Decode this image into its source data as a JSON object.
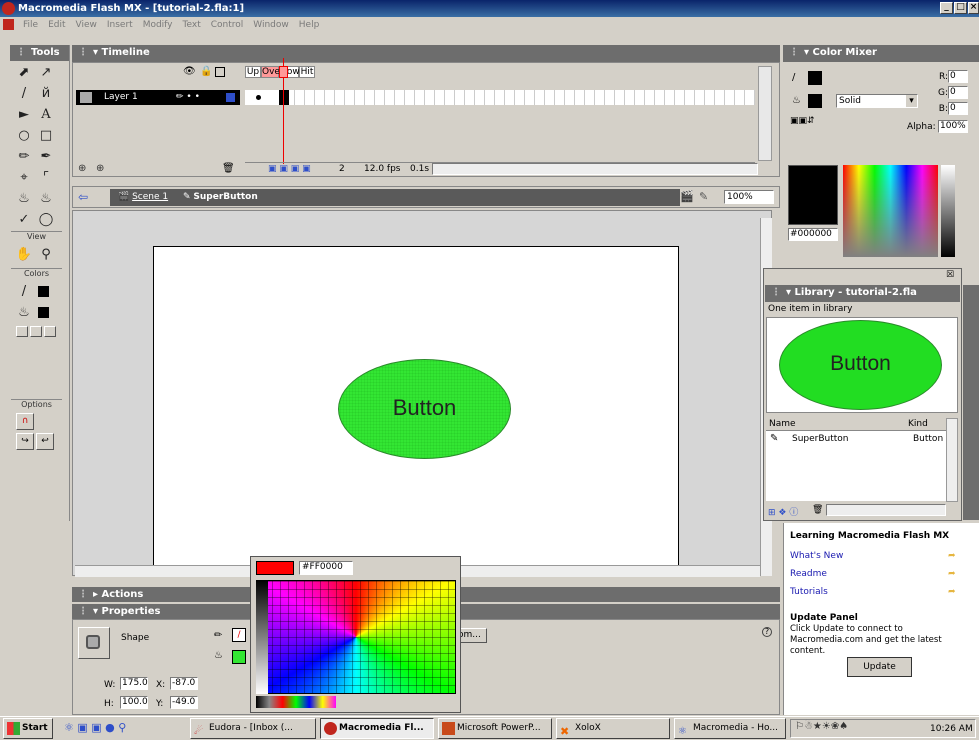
{
  "window": {
    "title": "Macromedia Flash MX - [tutorial-2.fla:1]"
  },
  "menu": [
    "File",
    "Edit",
    "View",
    "Insert",
    "Modify",
    "Text",
    "Control",
    "Window",
    "Help"
  ],
  "tools": {
    "title": "Tools",
    "view_label": "View",
    "colors_label": "Colors",
    "options_label": "Options"
  },
  "timeline": {
    "title": "Timeline",
    "layer_name": "Layer 1",
    "frame_labels": [
      "Up",
      "Over",
      "Down",
      "Hit"
    ],
    "frame_number": "2",
    "fps": "12.0 fps",
    "time": "0.1s"
  },
  "scene": {
    "scene_label": "Scene 1",
    "symbol_label": "SuperButton",
    "zoom": "100%"
  },
  "stage": {
    "button_text": "Button",
    "fill_color": "#33e633"
  },
  "swatch_popup": {
    "hex": "#FF0000"
  },
  "actions": {
    "title": "Actions"
  },
  "properties": {
    "title": "Properties",
    "shape_label": "Shape",
    "w_label": "W:",
    "w_value": "175.0",
    "x_label": "X:",
    "x_value": "-87.0",
    "h_label": "H:",
    "h_value": "100.0",
    "y_label": "Y:",
    "y_value": "-49.0",
    "custom_button_partial": "om..."
  },
  "color_mixer": {
    "title": "Color Mixer",
    "r_label": "R:",
    "r_value": "0",
    "g_label": "G:",
    "g_value": "0",
    "b_label": "B:",
    "b_value": "0",
    "alpha_label": "Alpha:",
    "alpha_value": "100%",
    "fill_style": "Solid",
    "hex": "#000000"
  },
  "library": {
    "title": "Library - tutorial-2.fla",
    "count_text": "One item in library",
    "preview_text": "Button",
    "col_name": "Name",
    "col_kind": "Kind",
    "item_name": "SuperButton",
    "item_kind": "Button"
  },
  "learning": {
    "title": "Learning Macromedia Flash MX",
    "links": [
      "What's New",
      "Readme",
      "Tutorials"
    ],
    "update_title": "Update Panel",
    "update_text": "Click Update to connect to Macromedia.com and get the latest content.",
    "update_button": "Update"
  },
  "taskbar": {
    "start": "Start",
    "tasks": [
      "Eudora - [Inbox (...",
      "Macromedia Fl...",
      "Microsoft PowerP...",
      "XoloX",
      "Macromedia - Ho..."
    ],
    "clock": "10:26 AM"
  }
}
